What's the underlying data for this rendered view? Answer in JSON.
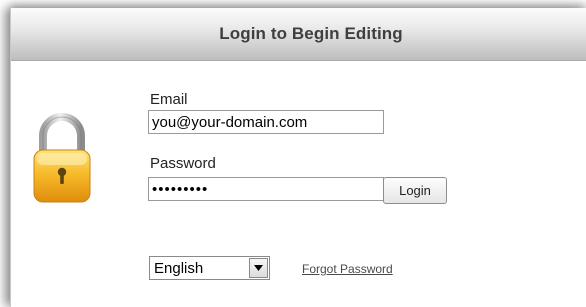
{
  "dialog": {
    "title": "Login to Begin Editing"
  },
  "form": {
    "email_label": "Email",
    "email_value": "you@your-domain.com",
    "password_label": "Password",
    "password_value": "•••••••••",
    "login_label": "Login"
  },
  "footer": {
    "language_selected": "English",
    "forgot_password_label": "Forgot Password"
  },
  "icons": {
    "lock": "padlock-icon",
    "dropdown": "chevron-down-icon"
  },
  "colors": {
    "lock_body": "#f2b21f",
    "lock_shackle": "#bfbfbf",
    "title_text": "#3f3f3f",
    "link_text": "#4a4a4a"
  }
}
